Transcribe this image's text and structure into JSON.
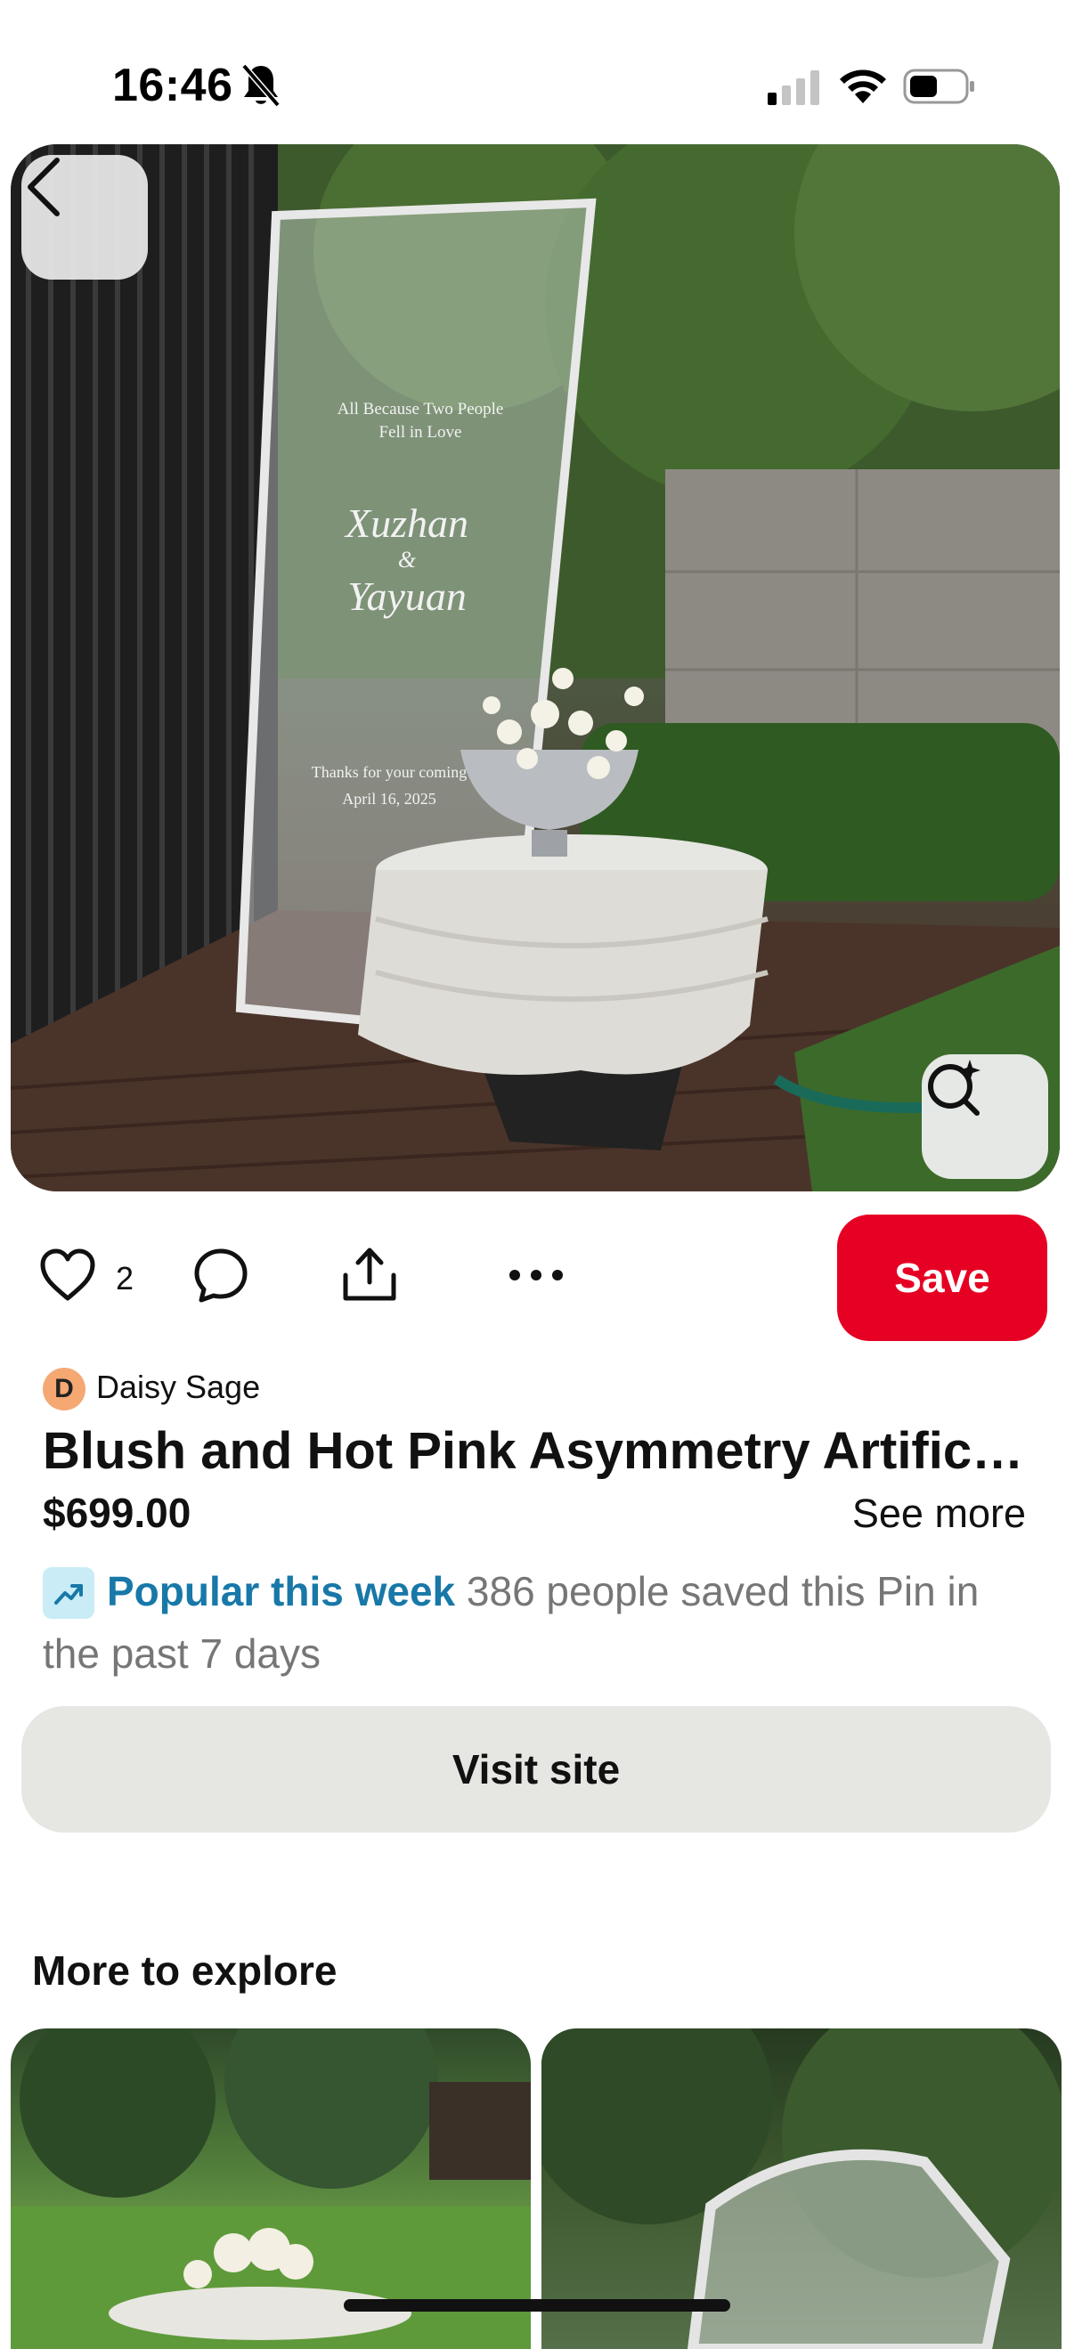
{
  "status_bar": {
    "time": "16:46",
    "icons": [
      "bell-off-icon",
      "signal-icon",
      "wifi-icon",
      "battery-icon"
    ]
  },
  "hero": {
    "sign": {
      "line1": "All Because Two People Fell in Love",
      "names_line1": "Xuzhan",
      "names_amp": "&",
      "names_line2": "Yayuan",
      "footer1": "Thanks for your coming",
      "footer2": "April 16, 2025"
    },
    "back_icon": "chevron-left-icon",
    "lens_icon": "visual-search-icon"
  },
  "actions": {
    "like_count": "2",
    "save_label": "Save",
    "icons": [
      "heart-icon",
      "comment-icon",
      "share-icon",
      "more-icon"
    ]
  },
  "pin": {
    "creator_initial": "D",
    "creator_name": "Daisy Sage",
    "title": "Blush and Hot Pink Asymmetry Artificial Flower Wedding Veil",
    "price": "$699.00",
    "see_more": "See more",
    "popular_label": "Popular this week",
    "popular_detail": "386 people saved this Pin in the past 7 days",
    "visit_label": "Visit site"
  },
  "explore": {
    "heading": "More to explore"
  },
  "colors": {
    "save": "#e60023",
    "popular": "#1878a8",
    "visit_bg": "#e6e6e2"
  }
}
